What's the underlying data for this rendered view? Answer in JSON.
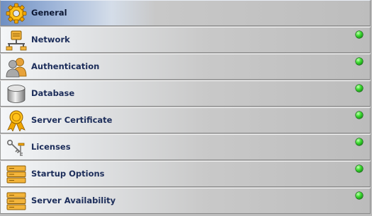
{
  "nav": {
    "items": [
      {
        "label": "General",
        "icon": "gear-icon",
        "selected": true,
        "status": null
      },
      {
        "label": "Network",
        "icon": "network-icon",
        "selected": false,
        "status": "ok"
      },
      {
        "label": "Authentication",
        "icon": "users-icon",
        "selected": false,
        "status": "ok"
      },
      {
        "label": "Database",
        "icon": "database-icon",
        "selected": false,
        "status": "ok"
      },
      {
        "label": "Server Certificate",
        "icon": "certificate-ribbon-icon",
        "selected": false,
        "status": "ok"
      },
      {
        "label": "Licenses",
        "icon": "keys-icon",
        "selected": false,
        "status": "ok"
      },
      {
        "label": "Startup Options",
        "icon": "server-rack-icon",
        "selected": false,
        "status": "ok"
      },
      {
        "label": "Server Availability",
        "icon": "server-rack-icon",
        "selected": false,
        "status": "ok"
      }
    ]
  },
  "colors": {
    "status_ok": "#2fc42a",
    "label_text": "#1c2d5a",
    "selected_accent": "#6f8fc2"
  }
}
